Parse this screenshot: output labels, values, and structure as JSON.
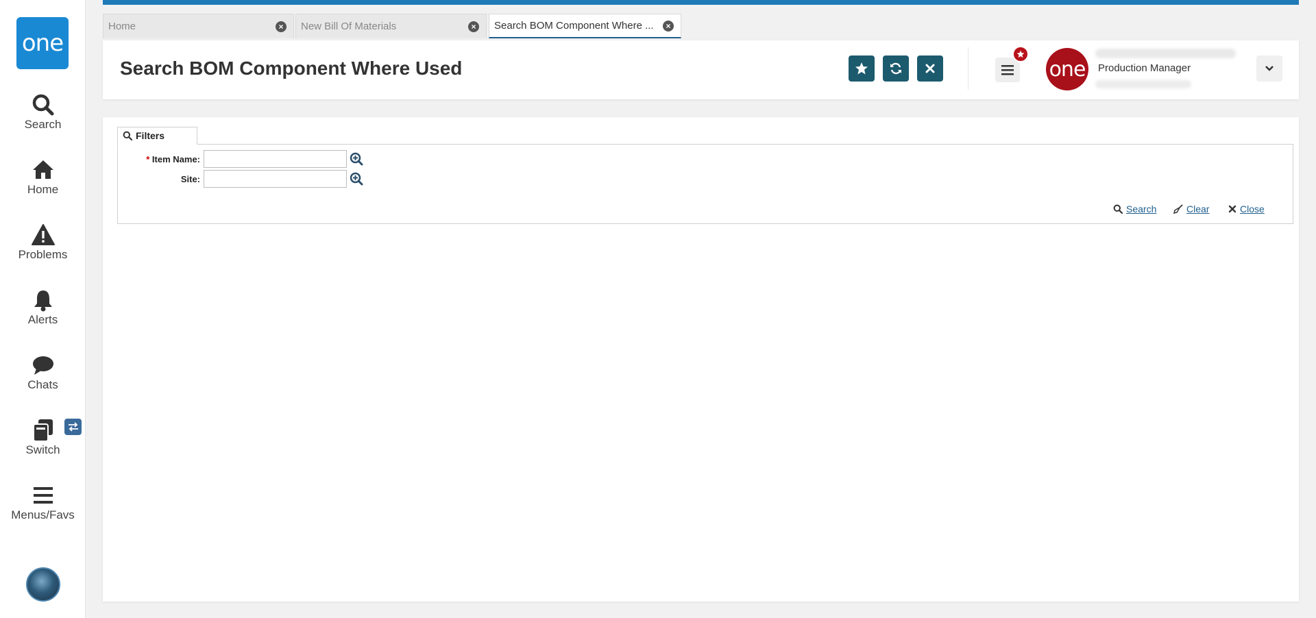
{
  "sidebar": {
    "logo_text": "one",
    "items": [
      {
        "label": "Search",
        "icon": "search-icon"
      },
      {
        "label": "Home",
        "icon": "home-icon"
      },
      {
        "label": "Problems",
        "icon": "warning-icon"
      },
      {
        "label": "Alerts",
        "icon": "bell-icon"
      },
      {
        "label": "Chats",
        "icon": "chat-icon"
      },
      {
        "label": "Switch",
        "icon": "switch-icon"
      },
      {
        "label": "Menus/Favs",
        "icon": "menu-icon"
      }
    ]
  },
  "tabs": [
    {
      "label": "Home",
      "active": false
    },
    {
      "label": "New Bill Of Materials",
      "active": false
    },
    {
      "label": "Search BOM Component Where ...",
      "active": true
    }
  ],
  "header": {
    "title": "Search BOM Component Where Used",
    "user_avatar_text": "one",
    "user_role": "Production Manager"
  },
  "filters": {
    "tab_label": "Filters",
    "fields": [
      {
        "label": "Item Name:",
        "required": true,
        "value": ""
      },
      {
        "label": "Site:",
        "required": false,
        "value": ""
      }
    ],
    "actions": {
      "search": "Search",
      "clear": "Clear",
      "close": "Close"
    }
  },
  "colors": {
    "accent": "#1f7ab8",
    "primary_button": "#1c5a6e",
    "brand_logo": "#1a89d4",
    "user_avatar": "#a8101a"
  }
}
